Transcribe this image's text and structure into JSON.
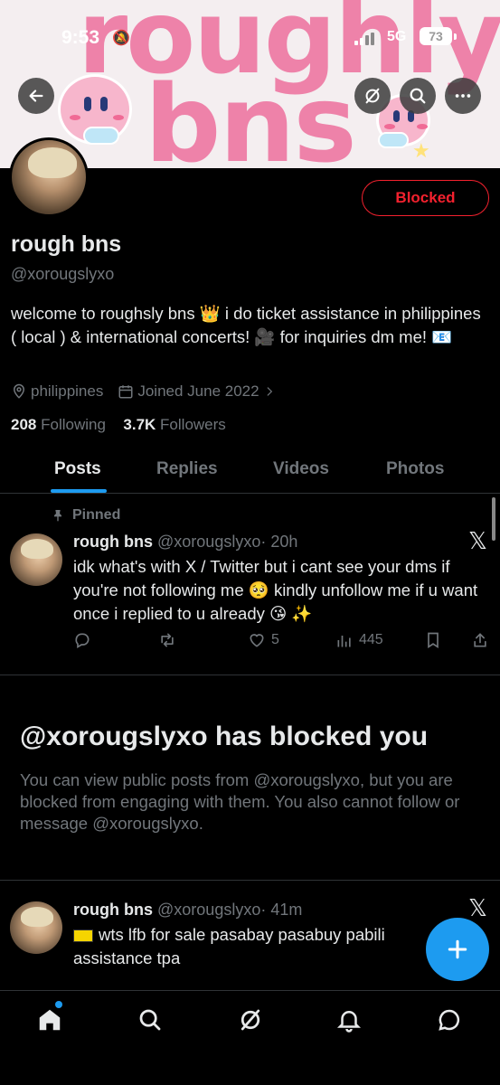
{
  "banner": {
    "line1": "roughly",
    "line2": "bns"
  },
  "status_bar": {
    "time": "9:53",
    "network": "5G",
    "battery": "73"
  },
  "profile": {
    "blocked_label": "Blocked",
    "name": "rough bns",
    "handle": "@xorougslyxo",
    "bio": "welcome to roughsly bns 👑 i do ticket assistance in philippines ( local ) & international concerts! 🎥 for inquiries dm me! 📧",
    "location": "philippines",
    "joined": "Joined June 2022",
    "following_count": "208",
    "following_label": "Following",
    "followers_count": "3.7K",
    "followers_label": "Followers"
  },
  "tabs": [
    "Posts",
    "Replies",
    "Videos",
    "Photos"
  ],
  "pinned_label": "Pinned",
  "tweets": [
    {
      "name": "rough bns",
      "handle": "@xorougslyxo",
      "time": "· 20h",
      "text": "idk what's with X / Twitter but i cant see your dms if you're not following me 🥺 kindly unfollow me if u want once i replied to u already 😘 ✨",
      "likes": "5",
      "views": "445"
    },
    {
      "name": "rough bns",
      "handle": "@xorougslyxo",
      "time": "· 41m",
      "text": "wts lfb for sale pasabay pasabuy pabili assistance tpa"
    }
  ],
  "blocked_notice": {
    "title": "@xorougslyxo has blocked you",
    "description": "You can view public posts from @xorougslyxo, but you are blocked from engaging with them. You also cannot follow or message @xorougslyxo."
  },
  "icons": {
    "back": "back-arrow-icon",
    "grok": "grok-icon",
    "search": "search-icon",
    "more": "more-icon",
    "fab": "plus-icon",
    "nav": [
      "home-icon",
      "search-icon",
      "grok-icon",
      "notifications-icon",
      "messages-icon"
    ]
  },
  "colors": {
    "accent": "#1d9bf0",
    "blocked": "#f4212e",
    "banner_pink": "#ee82a9"
  }
}
